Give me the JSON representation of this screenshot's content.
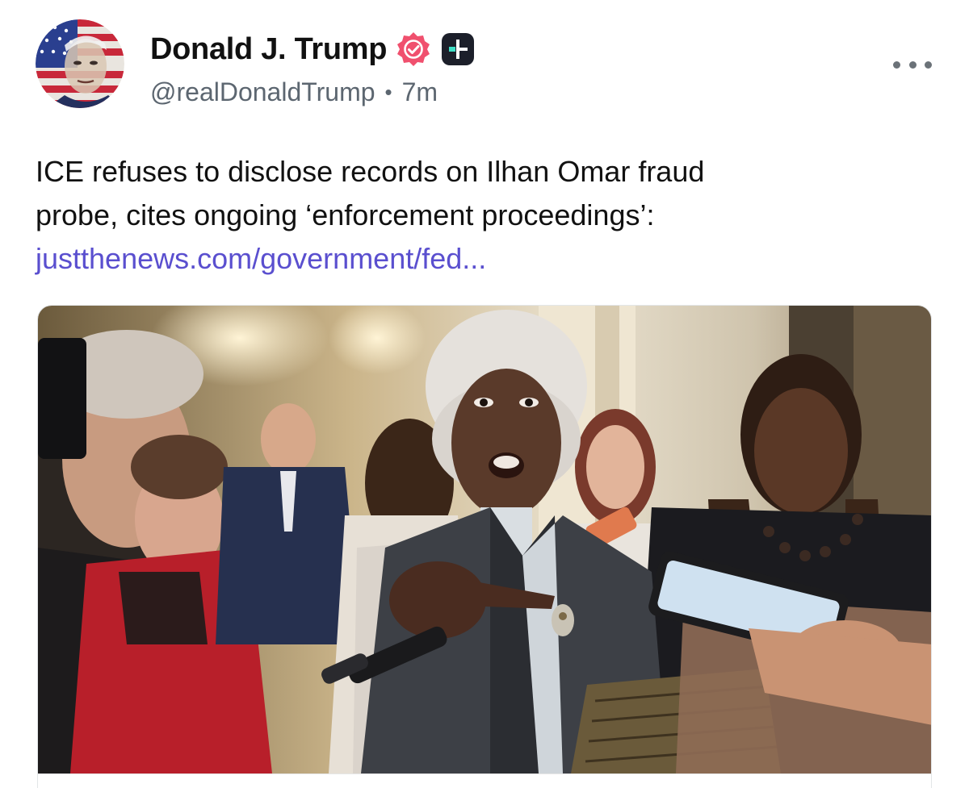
{
  "author": {
    "display_name": "Donald J. Trump",
    "handle": "@realDonaldTrump",
    "separator": "•",
    "time_ago": "7m",
    "verified_badge_icon": "verified-badge-icon",
    "plus_badge_icon": "plus-badge-icon",
    "verified_color": "#f0506e",
    "plus_badge_color": "#1c1f2a",
    "plus_badge_accent": "#3ee0c6"
  },
  "post": {
    "text_line_1": "ICE refuses to disclose records on Ilhan Omar fraud",
    "text_line_2": "probe, cites ongoing ‘enforcement proceedings’:",
    "link_text": "justthenews.com/government/fed...",
    "link_color": "#5a4fcf"
  },
  "menu": {
    "more_icon": "more-horizontal-icon"
  },
  "link_card": {
    "image_icon": "news-photo-image"
  }
}
